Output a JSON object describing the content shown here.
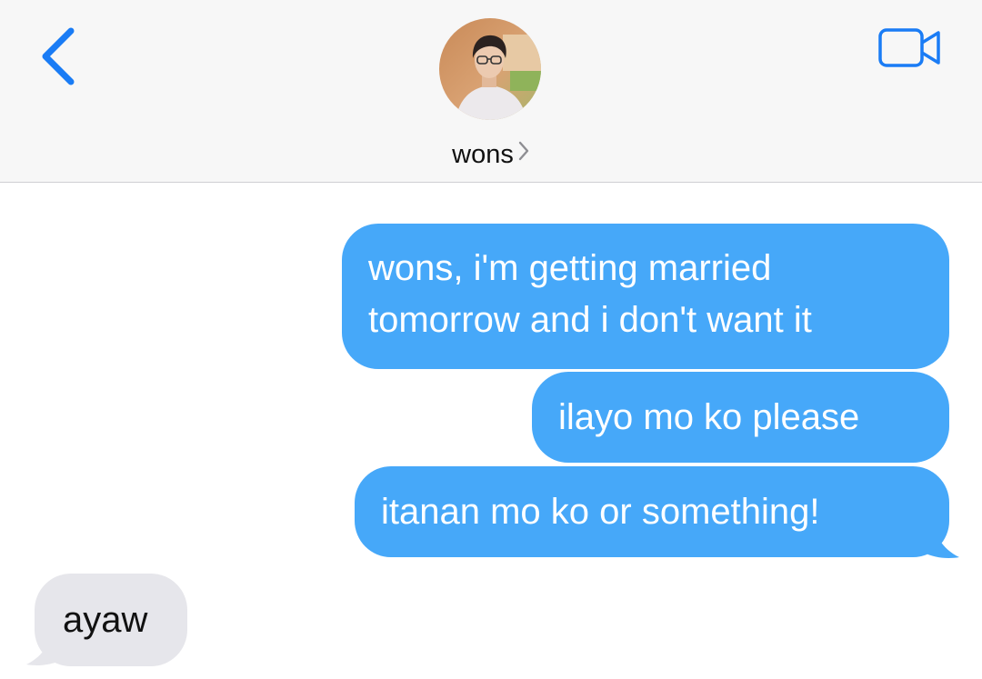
{
  "header": {
    "contact_name": "wons",
    "back_icon": "chevron-left-icon",
    "video_icon": "video-camera-icon",
    "name_chevron_icon": "chevron-right-icon",
    "accent_color": "#1a7cf5"
  },
  "messages": [
    {
      "direction": "outgoing",
      "lines": [
        "wons, i'm getting married",
        "tomorrow and i don't want it"
      ]
    },
    {
      "direction": "outgoing",
      "text": "ilayo mo ko please"
    },
    {
      "direction": "outgoing",
      "text": "itanan mo ko or something!"
    },
    {
      "direction": "incoming",
      "text": "ayaw"
    }
  ],
  "colors": {
    "outgoing_bubble": "#46a8f9",
    "incoming_bubble": "#e6e6eb",
    "header_bg": "#f7f7f7"
  }
}
